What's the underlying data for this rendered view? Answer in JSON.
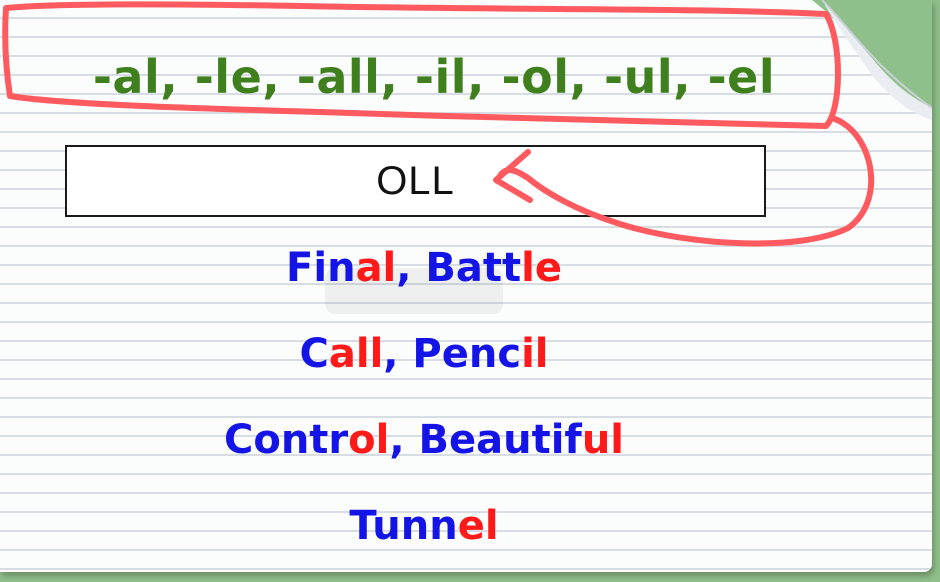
{
  "suffixes": {
    "text": "-al, -le, -all, -il, -ol, -ul, -el"
  },
  "answer_box": {
    "text": "OLL"
  },
  "rows": [
    {
      "parts": [
        {
          "text": "Fin",
          "accent": false
        },
        {
          "text": "al",
          "accent": true
        },
        {
          "text": ", Batt",
          "accent": false
        },
        {
          "text": "le",
          "accent": true
        }
      ]
    },
    {
      "parts": [
        {
          "text": "C",
          "accent": false
        },
        {
          "text": "all",
          "accent": true
        },
        {
          "text": ", Penc",
          "accent": false
        },
        {
          "text": "il",
          "accent": true
        }
      ]
    },
    {
      "parts": [
        {
          "text": "Contr",
          "accent": false
        },
        {
          "text": "ol",
          "accent": true
        },
        {
          "text": ", Beautif",
          "accent": false
        },
        {
          "text": "ul",
          "accent": true
        }
      ]
    },
    {
      "parts": [
        {
          "text": "Tunn",
          "accent": false
        },
        {
          "text": "el",
          "accent": true
        }
      ]
    }
  ],
  "colors": {
    "suffix_green": "#3f7f1d",
    "word_blue": "#1414e6",
    "word_red": "#ff1a1a",
    "annotation_red": "#ff5a5f"
  },
  "icons": {
    "page_curl": "page-curl-icon",
    "annotation": "red-marker-circle-arrow"
  }
}
